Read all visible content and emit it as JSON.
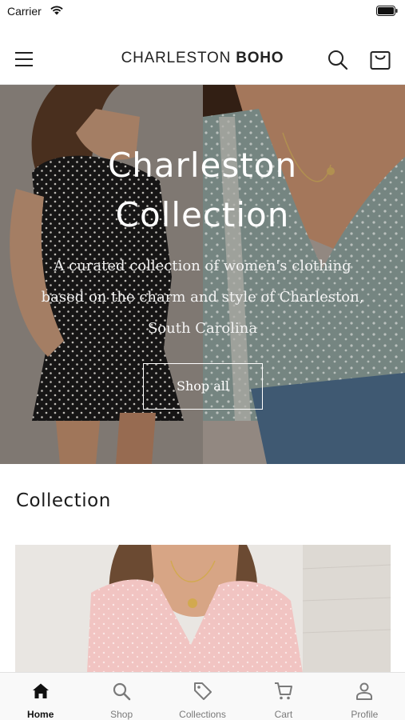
{
  "status_bar": {
    "carrier": "Carrier"
  },
  "header": {
    "brand_light": "CHARLESTON ",
    "brand_bold": "BOHO"
  },
  "hero": {
    "title_line1": "Charleston",
    "title_line2": "Collection",
    "subtitle": "A curated collection of women's clothing based on the charm and style of Charleston, South Carolina",
    "button_label": "Shop all"
  },
  "collection": {
    "title": "Collection"
  },
  "tabs": [
    {
      "label": "Home",
      "icon": "home-icon",
      "active": true
    },
    {
      "label": "Shop",
      "icon": "search-icon",
      "active": false
    },
    {
      "label": "Collections",
      "icon": "tag-icon",
      "active": false
    },
    {
      "label": "Cart",
      "icon": "cart-icon",
      "active": false
    },
    {
      "label": "Profile",
      "icon": "person-icon",
      "active": false
    }
  ]
}
